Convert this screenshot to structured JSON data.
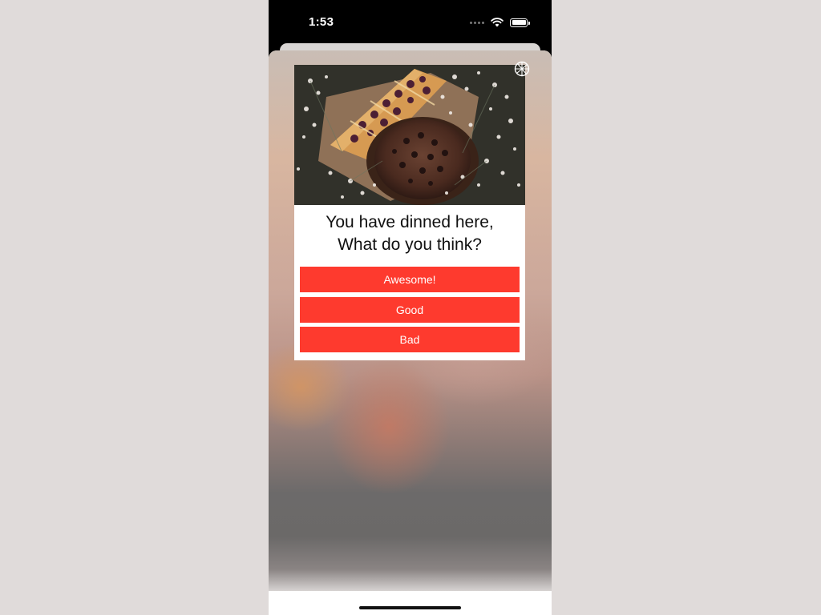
{
  "status_bar": {
    "time": "1:53",
    "icons": [
      "cellular-icon",
      "wifi-icon",
      "battery-icon"
    ]
  },
  "popup": {
    "close_icon": "close-icon",
    "image": "food-photo",
    "title_line1": "You have dinned here,",
    "title_line2": "What do you think?",
    "options": [
      {
        "label": "Awesome!"
      },
      {
        "label": "Good"
      },
      {
        "label": "Bad"
      }
    ]
  },
  "colors": {
    "accent": "#fe3a2e",
    "status_bar": "#000000",
    "background": "#e0dbda"
  }
}
